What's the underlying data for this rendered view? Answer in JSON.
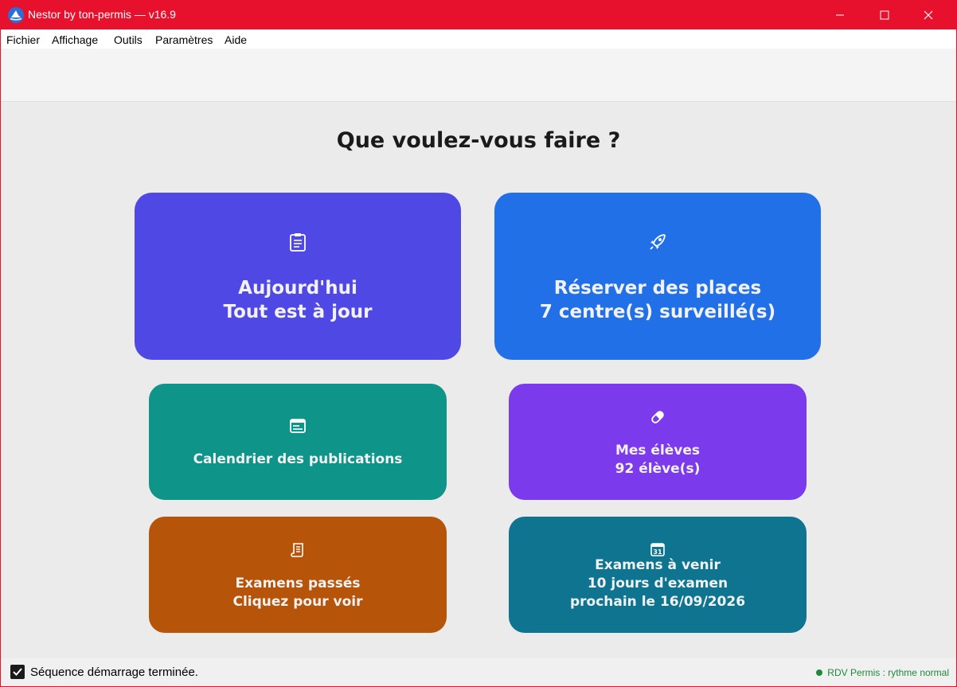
{
  "window": {
    "title": "Nestor by ton-permis — v16.9",
    "accent": "#e8112d"
  },
  "menu": [
    "Fichier",
    "Affichage",
    "Outils",
    "Paramètres",
    "Aide"
  ],
  "heading": "Que voulez-vous faire ?",
  "tiles": {
    "today": {
      "icon": "clipboard-icon",
      "color": "#5048e5",
      "lines": [
        "Aujourd'hui",
        "Tout est à jour"
      ]
    },
    "reserve": {
      "icon": "rocket-icon",
      "color": "#2170e8",
      "lines": [
        "Réserver des places",
        "7 centre(s) surveillé(s)"
      ]
    },
    "calendar": {
      "icon": "newspaper-icon",
      "color": "#0e9488",
      "lines": [
        "Calendrier des publications"
      ]
    },
    "students": {
      "icon": "pill-icon",
      "color": "#7c3aed",
      "lines": [
        "Mes élèves",
        "92 élève(s)"
      ]
    },
    "past": {
      "icon": "scroll-icon",
      "color": "#b6540a",
      "lines": [
        "Examens passés",
        "Cliquez pour voir"
      ]
    },
    "upcoming": {
      "icon": "calendar-31-icon",
      "color": "#0e7490",
      "lines": [
        "Examens à venir",
        "10 jours d'examen",
        "prochain le 16/09/2026"
      ]
    }
  },
  "status": {
    "message": "Séquence démarrage terminée.",
    "right": "RDV Permis : rythme normal",
    "right_color": "#1d8a3a"
  }
}
